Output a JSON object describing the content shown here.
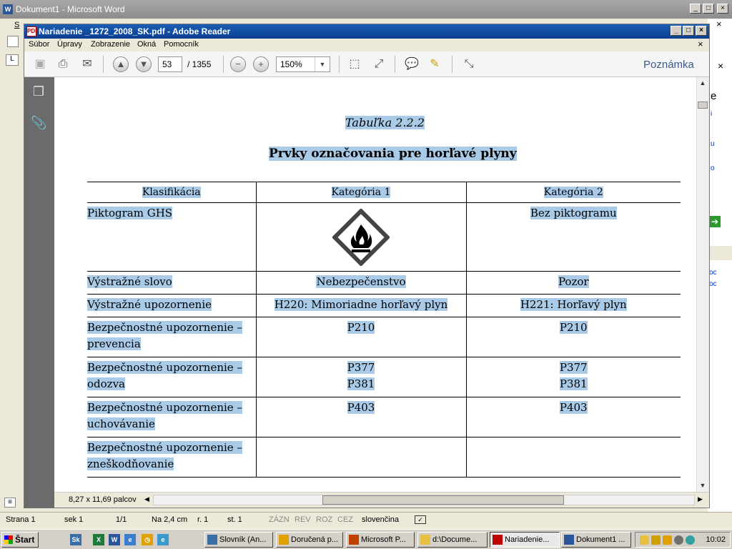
{
  "word": {
    "title": "Dokument1 - Microsoft Word",
    "menu_first_letter": "S",
    "right_task_chars": [
      "e",
      "i",
      "u",
      "o",
      "oc",
      "oc"
    ],
    "status": {
      "page": "Strana  1",
      "section": "sek  1",
      "pages": "1/1",
      "at": "Na  2,4 cm",
      "line": "r.  1",
      "col": "st.  1",
      "rec": "ZÁZN",
      "rev": "REV",
      "ext": "ROZ",
      "ovr": "CEZ",
      "lang": "slovenčina"
    }
  },
  "reader": {
    "title": "Nariadenie _1272_2008_SK.pdf - Adobe Reader",
    "menu": [
      "Súbor",
      "Úpravy",
      "Zobrazenie",
      "Okná",
      "Pomocník"
    ],
    "toolbar": {
      "page_current": "53",
      "page_total": "/ 1355",
      "zoom": "150%",
      "note_label": "Poznámka"
    },
    "page_size": "8,27 x 11,69 palcov"
  },
  "document": {
    "caption": "Tabuľka 2.2.2",
    "heading": "Prvky označovania pre horľavé plyny",
    "table": {
      "headers": [
        "Klasifikácia",
        "Kategória 1",
        "Kategória 2"
      ],
      "rows": [
        {
          "label": [
            "Piktogram GHS"
          ],
          "cat1": [],
          "cat2": [
            "Bez piktogramu"
          ],
          "pictogram": "flame-pictogram"
        },
        {
          "label": [
            "Výstražné slovo"
          ],
          "cat1": [
            "Nebezpečenstvo"
          ],
          "cat2": [
            "Pozor"
          ]
        },
        {
          "label": [
            "Výstražné upozornenie"
          ],
          "cat1": [
            "H220: Mimoriadne horľavý plyn"
          ],
          "cat2": [
            "H221: Horľavý plyn"
          ]
        },
        {
          "label": [
            "Bezpečnostné upozornenie –",
            "prevencia"
          ],
          "cat1": [
            "P210"
          ],
          "cat2": [
            "P210"
          ]
        },
        {
          "label": [
            "Bezpečnostné upozornenie –",
            "odozva"
          ],
          "cat1": [
            "P377",
            "P381"
          ],
          "cat2": [
            "P377",
            "P381"
          ]
        },
        {
          "label": [
            "Bezpečnostné upozornenie –",
            "uchovávanie"
          ],
          "cat1": [
            "P403"
          ],
          "cat2": [
            "P403"
          ]
        },
        {
          "label": [
            "Bezpečnostné upozornenie –",
            "zneškodňovanie"
          ],
          "cat1": [],
          "cat2": []
        }
      ]
    }
  },
  "taskbar": {
    "start": "Štart",
    "tasks": [
      {
        "label": "Slovník (An...",
        "icon_color": "#3a6ea5",
        "active": false
      },
      {
        "label": "Doručená p...",
        "icon_color": "#e0a000",
        "active": false
      },
      {
        "label": "Microsoft P...",
        "icon_color": "#c04000",
        "active": false
      },
      {
        "label": "d:\\Docume...",
        "icon_color": "#e8c040",
        "active": false
      },
      {
        "label": "Nariadenie...",
        "icon_color": "#c00000",
        "active": true
      },
      {
        "label": "Dokument1 ...",
        "icon_color": "#2b579a",
        "active": false
      }
    ],
    "clock": "10:02"
  },
  "colors": {
    "selection": "#a9cbe8",
    "reader_title": "#0a3d91",
    "side_panel": "#6b6b6b"
  }
}
